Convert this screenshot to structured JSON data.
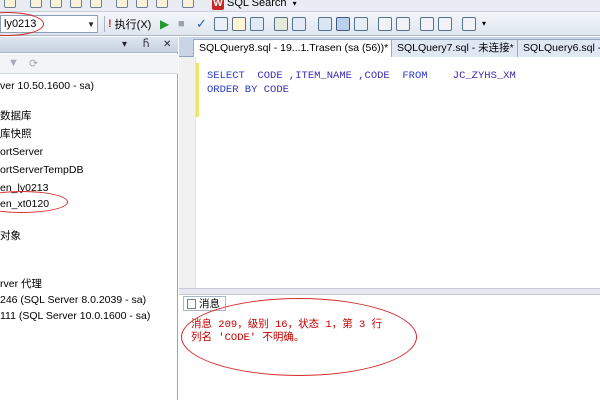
{
  "toolbar_top": {
    "search_label": "SQL Search"
  },
  "toolbar": {
    "database_value": "ly0213",
    "execute_label": "执行(X)"
  },
  "left_panel": {
    "items": [
      "ver 10.50.1600 - sa)",
      "数据库",
      "库快照",
      "ortServer",
      "ortServerTempDB",
      "en_ly0213",
      "en_xt0120",
      "对象",
      "rver 代理",
      "246 (SQL Server 8.0.2039 - sa)",
      "111 (SQL Server 10.0.1600 - sa)"
    ]
  },
  "tabs": [
    "SQLQuery8.sql - 19...1.Trasen (sa (56))*",
    "SQLQuery7.sql - 未连接*",
    "SQLQuery6.sql -"
  ],
  "editor": {
    "line1_kw1": "SELECT",
    "line1_rest": "  CODE ,ITEM_NAME ,CODE  ",
    "line1_kw2": "FROM",
    "line1_table": "    JC_ZYHS_XM",
    "line2_kw": "ORDER BY",
    "line2_rest": " CODE"
  },
  "messages": {
    "tab_label": "消息",
    "line1": "消息 209，级别 16，状态 1，第 3 行",
    "line2": "列名 'CODE' 不明确。"
  },
  "colors": {
    "highlight": "#d52a2a",
    "error_text": "#c40000",
    "code_text": "#3b2ab2"
  }
}
